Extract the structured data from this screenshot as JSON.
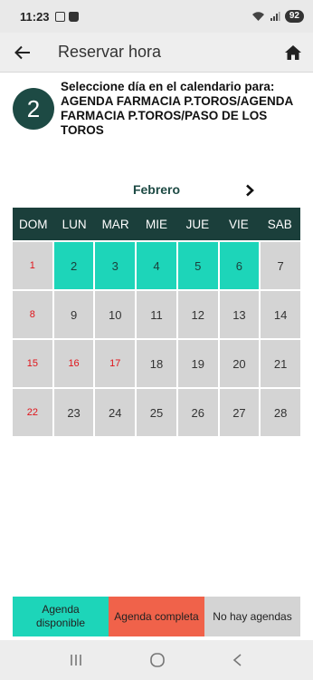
{
  "status": {
    "time": "11:23",
    "battery": "92"
  },
  "appbar": {
    "title": "Reservar hora"
  },
  "step": {
    "number": "2",
    "text": "Seleccione día en el calendario para: AGENDA FARMACIA P.TOROS/AGENDA FARMACIA P.TOROS/PASO DE LOS TOROS"
  },
  "calendar": {
    "month": "Febrero",
    "weekdays": [
      "DOM",
      "LUN",
      "MAR",
      "MIE",
      "JUE",
      "VIE",
      "SAB"
    ],
    "days": [
      "1",
      "2",
      "3",
      "4",
      "5",
      "6",
      "7",
      "8",
      "9",
      "10",
      "11",
      "12",
      "13",
      "14",
      "15",
      "16",
      "17",
      "18",
      "19",
      "20",
      "21",
      "22",
      "23",
      "24",
      "25",
      "26",
      "27",
      "28"
    ]
  },
  "legend": {
    "available": "Agenda disponible",
    "full": "Agenda completa",
    "none": "No hay agendas"
  },
  "colors": {
    "available": "#1dd5b9",
    "full": "#f0624a",
    "none": "#d4d4d4",
    "header": "#1b3f3b",
    "sunday_text": "#e0141a"
  }
}
